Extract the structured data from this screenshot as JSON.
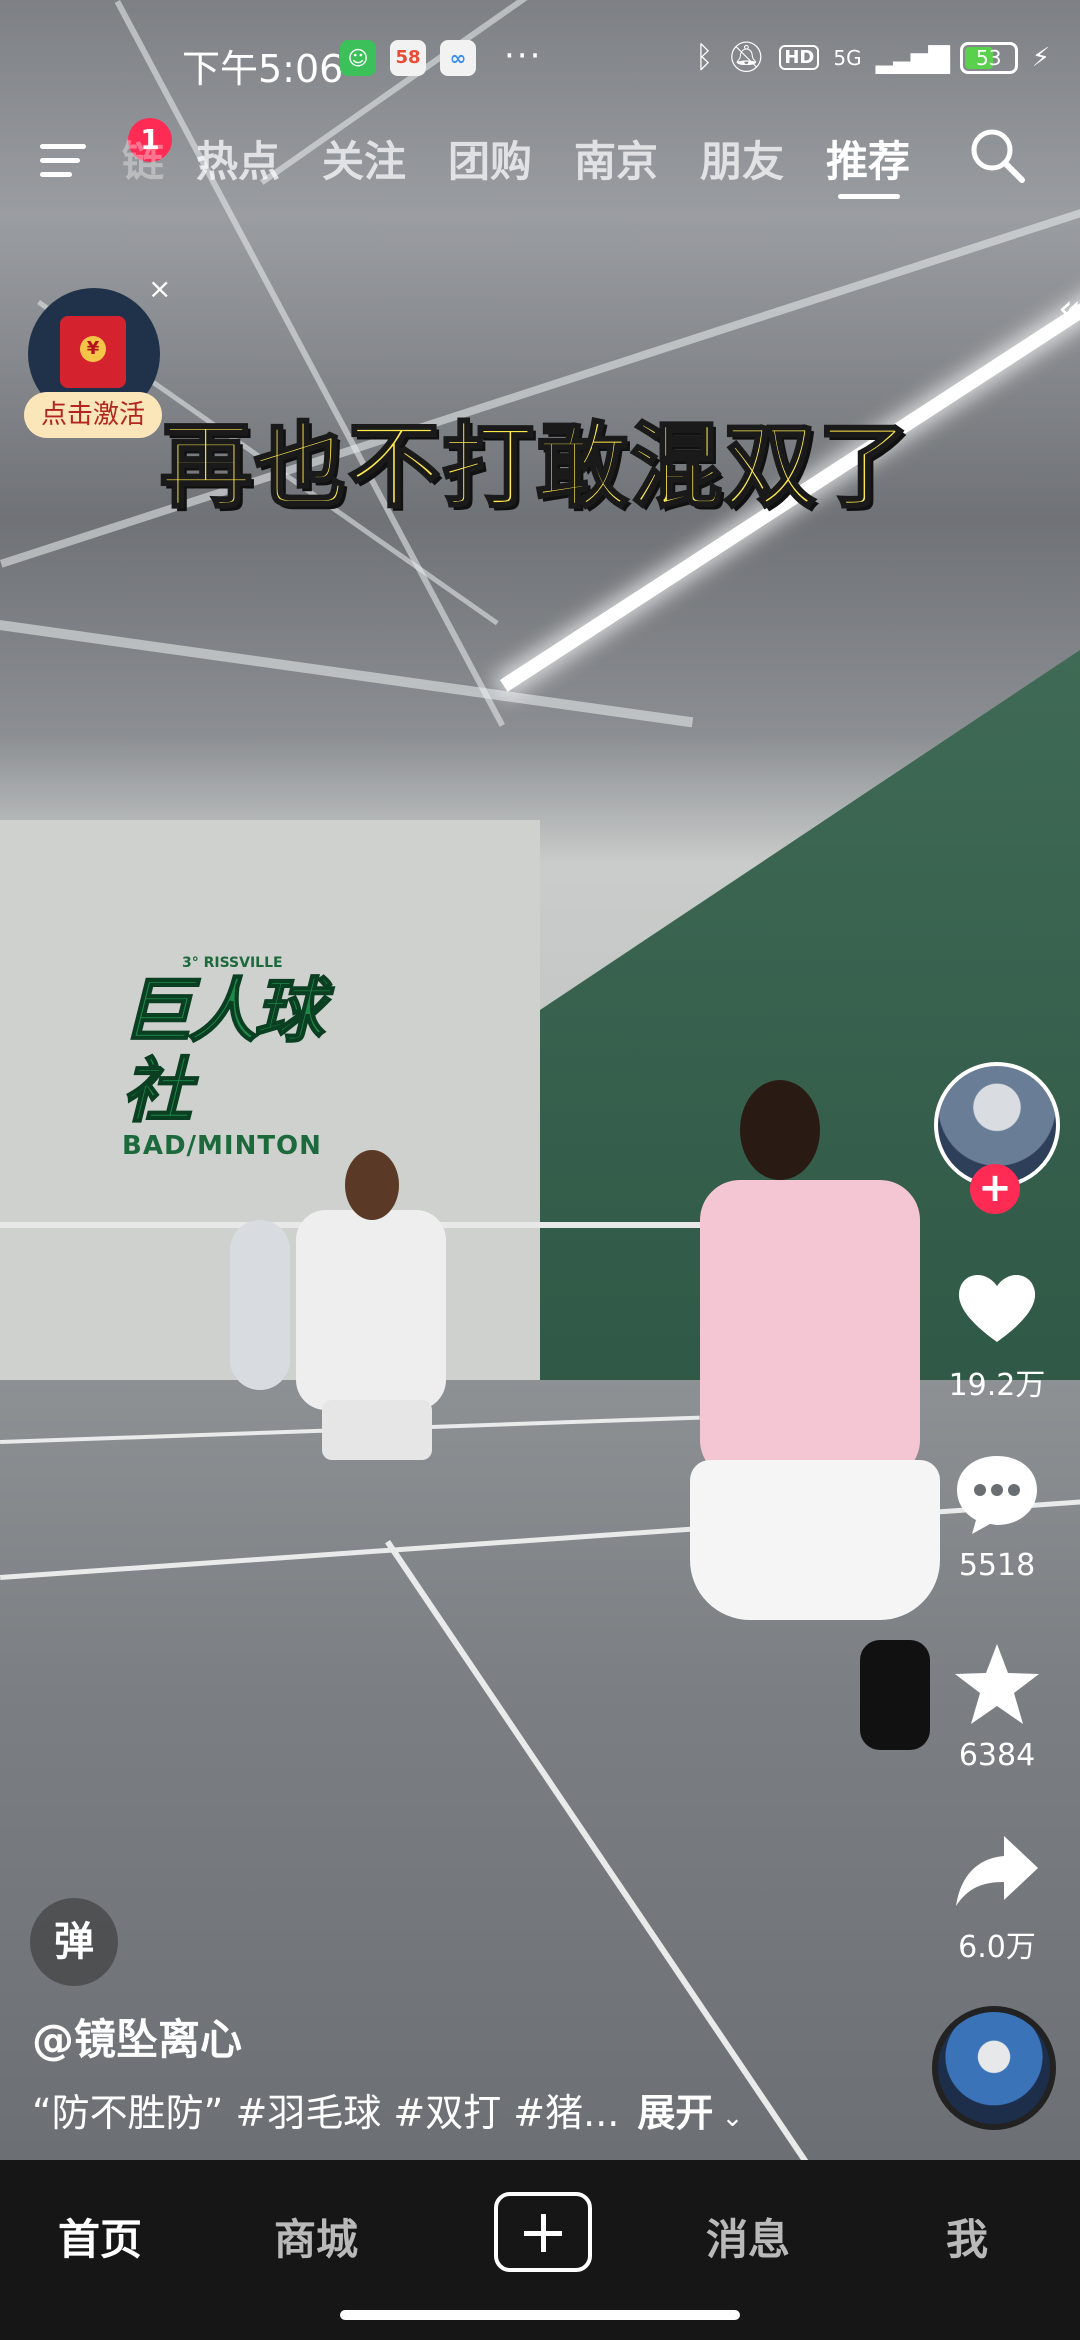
{
  "status_bar": {
    "time": "下午5:06",
    "app_icons": [
      "cat-app-icon",
      "58-app-icon",
      "cloud-app-icon"
    ],
    "more": "···",
    "network": "5G",
    "hd": "HD",
    "battery": "53"
  },
  "top_nav": {
    "badge": "1",
    "tabs": [
      {
        "label": "热点"
      },
      {
        "label": "关注"
      },
      {
        "label": "团购"
      },
      {
        "label": "南京"
      },
      {
        "label": "朋友"
      },
      {
        "label": "推荐"
      }
    ],
    "partial_tab": "链",
    "active_tab": "推荐"
  },
  "red_packet": {
    "close": "×",
    "label": "点击激活"
  },
  "video": {
    "caption": "再也不打敢混双了",
    "logo_text": "巨人球社",
    "logo_sub": "BAD/MINTON",
    "logo_small": "3° RISSVILLE"
  },
  "right_rail": {
    "follow": "+",
    "likes": "19.2万",
    "comments": "5518",
    "favorites": "6384",
    "shares": "6.0万"
  },
  "info": {
    "danmu": "弹",
    "author": "@镜坠离心",
    "description": "“防不胜防” #羽毛球 #双打 #猪...",
    "expand": "展开"
  },
  "bottom_nav": {
    "home": "首页",
    "shop": "商城",
    "messages": "消息",
    "me": "我"
  },
  "colors": {
    "accent": "#fe2c55",
    "caption": "#ffe94a",
    "battery": "#59d14c"
  }
}
